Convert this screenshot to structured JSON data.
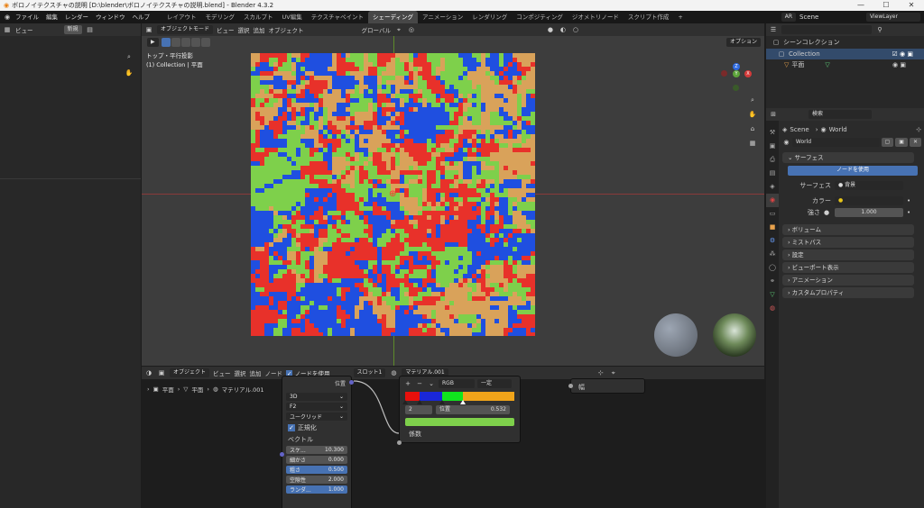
{
  "window": {
    "title": "ボロノイテクスチャの説明 [D:\\blender\\ボロノイテクスチャの説明.blend] - Blender 4.3.2",
    "controls": [
      "—",
      "☐",
      "✕"
    ]
  },
  "menu": [
    "ファイル",
    "編集",
    "レンダー",
    "ウィンドウ",
    "ヘルプ"
  ],
  "workspaces": [
    "レイアウト",
    "モデリング",
    "スカルプト",
    "UV編集",
    "テクスチャペイント",
    "シェーディング",
    "アニメーション",
    "レンダリング",
    "コンポジティング",
    "ジオメトリノード",
    "スクリプト作成"
  ],
  "active_workspace": "シェーディング",
  "top_right": {
    "ar": "AR",
    "scene": "Scene",
    "view_layer": "ViewLayer"
  },
  "file_browser": {
    "view": "ビュー",
    "new": "新規"
  },
  "viewport": {
    "mode": "オブジェクトモード",
    "menus": [
      "ビュー",
      "選択",
      "追加",
      "オブジェクト"
    ],
    "orient": "グローバル",
    "options": "オプション",
    "info_line1": "トップ・平行投影",
    "info_line2": "(1) Collection | 平面",
    "gizmo": {
      "z": "Z",
      "y": "Y",
      "x": "X"
    }
  },
  "colors": {
    "red": "#e8312a",
    "green": "#7ed04b",
    "blue": "#1f4fe0",
    "tan": "#d9a25a",
    "accent": "#4772b3"
  },
  "outliner": {
    "search_placeholder": "",
    "root": "シーンコレクション",
    "collection": "Collection",
    "object": "平面"
  },
  "properties": {
    "search_placeholder": "検索",
    "scene": "Scene",
    "world": "World",
    "world_name": "World",
    "surface_header": "サーフェス",
    "use_nodes": "ノードを使用",
    "surface_label": "サーフェス",
    "surface_value": "背景",
    "color_label": "カラー",
    "strength_label": "強さ",
    "strength_value": "1.000",
    "sections": [
      "ボリューム",
      "ミストパス",
      "設定",
      "ビューポート表示",
      "アニメーション",
      "カスタムプロパティ"
    ]
  },
  "node_editor": {
    "mode": "オブジェクト",
    "menus": [
      "ビュー",
      "選択",
      "追加",
      "ノード"
    ],
    "use_nodes": "ノードを使用",
    "slot": "スロット1",
    "material": "マテリアル.001",
    "breadcrumb": [
      "平面",
      "平面",
      "マテリアル.001"
    ]
  },
  "voronoi_node": {
    "output_label": "位置",
    "dims": "3D",
    "feature": "F2",
    "distance": "ユークリッド",
    "normalize": "正規化",
    "vector": "ベクトル",
    "fields": [
      {
        "label": "スケ...",
        "value": "10.300"
      },
      {
        "label": "細かさ",
        "value": "0.000"
      },
      {
        "label": "粗さ",
        "value": "0.500"
      },
      {
        "label": "空隙性",
        "value": "2.000"
      },
      {
        "label": "ランダ...",
        "value": "1.000"
      }
    ]
  },
  "ramp_node": {
    "mode": "RGB",
    "interp": "一定",
    "index": "2",
    "pos_label": "位置",
    "pos_value": "0.532",
    "factor": "係数",
    "stops": [
      {
        "pos": 0.0,
        "color": "#e8100c"
      },
      {
        "pos": 0.13,
        "color": "#1a27d8"
      },
      {
        "pos": 0.34,
        "color": "#10e51e"
      },
      {
        "pos": 0.532,
        "color": "#f0a41a"
      }
    ]
  },
  "width_node": {
    "label": "幅"
  }
}
